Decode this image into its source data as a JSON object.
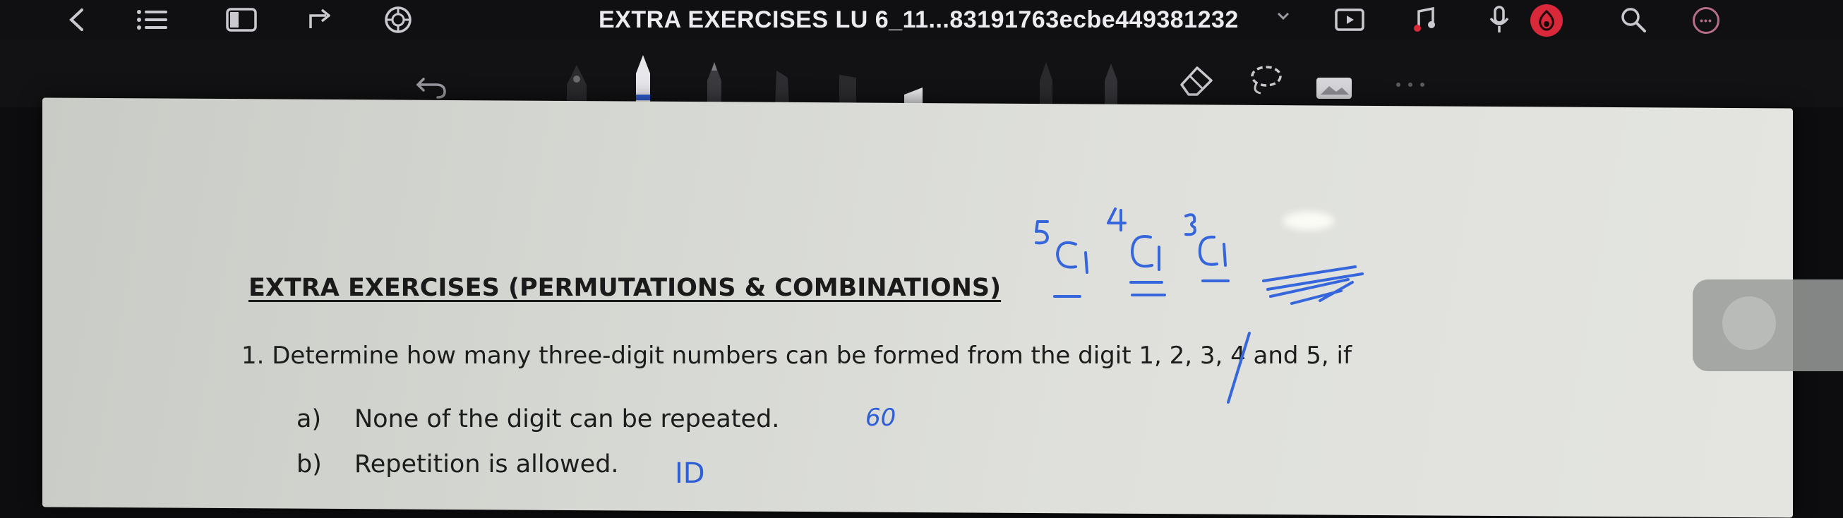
{
  "toolbar": {
    "title": "EXTRA EXERCISES LU 6_11...83191763ecbe449381232",
    "left_icons": [
      "back-chevron-icon",
      "list-icon",
      "sidebar-icon",
      "share-icon",
      "ai-assistant-icon"
    ],
    "right_icons": [
      "present-icon",
      "music-icon",
      "microphone-icon",
      "record-icon",
      "search-icon",
      "more-icon"
    ],
    "more_glyph": "•••",
    "accent_record": "#d8283a"
  },
  "pen_tools": [
    "undo-icon",
    "fountain-pen-icon",
    "ballpoint-pen-icon",
    "pencil-icon",
    "highlighter-icon",
    "marker-icon",
    "thin-pen-icon",
    "pencil-alt-icon",
    "eraser-icon",
    "lasso-icon",
    "sticky-note-icon",
    "tool-overflow-icon"
  ],
  "document": {
    "heading": "EXTRA EXERCISES (PERMUTATIONS & COMBINATIONS)",
    "question": "1. Determine how many three-digit numbers can be formed from the digit 1, 2, 3, 4 and 5, if",
    "part_a_label": "a)",
    "part_a_text": "None of the digit can be repeated.",
    "part_b_label": "b)",
    "part_b_text": "Repetition is allowed."
  },
  "annotations": {
    "answer_a": "60",
    "answer_b": "ID"
  },
  "ink_color": "#2f5fd6"
}
